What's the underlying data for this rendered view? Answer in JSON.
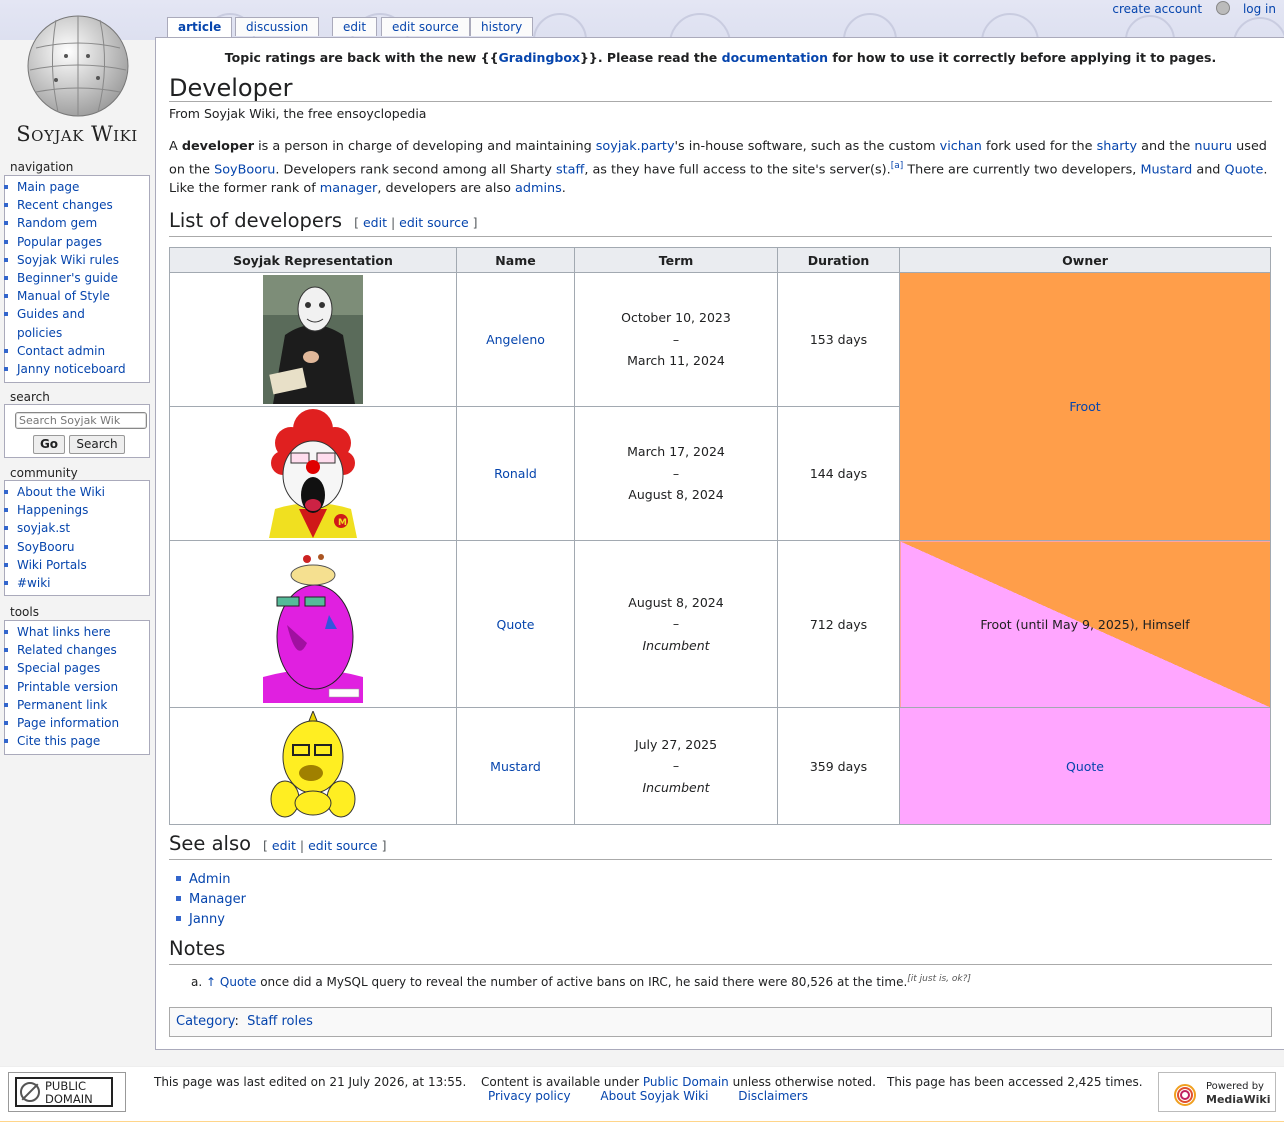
{
  "site": {
    "logo_text": "Soyjak Wiki"
  },
  "personal_tools": {
    "create_account": "create account",
    "log_in": "log in"
  },
  "tabs": [
    "article",
    "discussion",
    "edit",
    "edit source",
    "history"
  ],
  "sitenotice": {
    "before": "Topic ratings are back with the new {{",
    "link1": "Gradingbox",
    "middle": "}}. Please read the ",
    "link2": "documentation",
    "after": " for how to use it correctly before applying it to pages."
  },
  "page": {
    "title": "Developer",
    "tagline": "From Soyjak Wiki, the free ensoyclopedia"
  },
  "intro": {
    "t1": "A ",
    "bold": "developer",
    "t2": " is a person in charge of developing and maintaining ",
    "l1": "soyjak.party",
    "t3": "'s in-house software, such as the custom ",
    "l2": "vichan",
    "t4": " fork used for the ",
    "l3": "sharty",
    "t5": " and the ",
    "l4": "nuuru",
    "t6": " used on the ",
    "l5": "SoyBooru",
    "t7": ". Developers rank second among all Sharty ",
    "l6": "staff",
    "t8": ", as they have full access to the site's server(s).",
    "ref": "[a]",
    "t9": " There are currently two developers, ",
    "l7": "Mustard",
    "t10": " and ",
    "l8": "Quote",
    "t11": ". Like the former rank of ",
    "l9": "manager",
    "t12": ", developers are also ",
    "l10": "admins",
    "t13": "."
  },
  "sections": {
    "list_title": "List of developers",
    "see_also_title": "See also",
    "notes_title": "Notes",
    "edit": "edit",
    "edit_source": "edit source",
    "bracket_open": "[",
    "bracket_close": "]",
    "sep": "|"
  },
  "table": {
    "headers": [
      "Soyjak Representation",
      "Name",
      "Term",
      "Duration",
      "Owner"
    ],
    "rows": [
      {
        "name": "Angeleno",
        "start": "October 10, 2023",
        "dash": "–",
        "end": "March 11, 2024",
        "duration": "153 days"
      },
      {
        "name": "Ronald",
        "start": "March 17, 2024",
        "dash": "–",
        "end": "August 8, 2024",
        "duration": "144 days"
      },
      {
        "name": "Quote",
        "start": "August 8, 2024",
        "dash": "–",
        "end": "Incumbent",
        "duration": "712 days"
      },
      {
        "name": "Mustard",
        "start": "July 27, 2025",
        "dash": "–",
        "end": "Incumbent",
        "duration": "359 days"
      }
    ],
    "owners": [
      "Froot",
      "Froot (until May 9, 2025), Himself",
      "Quote"
    ],
    "colors": {
      "orange": "#ff9e4a",
      "pink": "#ffa6ff"
    }
  },
  "see_also": [
    "Admin",
    "Manager",
    "Janny"
  ],
  "notes": {
    "marker": "a.",
    "arrow": "↑",
    "link": "Quote",
    "text": " once did a MySQL query to reveal the number of active bans on IRC, he said there were 80,526 at the time.",
    "sup": "[it just is, ok?]"
  },
  "category": {
    "label": "Category",
    "colon": ":",
    "value": "Staff roles"
  },
  "sidebar": {
    "navigation": {
      "heading": "navigation",
      "items": [
        "Main page",
        "Recent changes",
        "Random gem",
        "Popular pages",
        "Soyjak Wiki rules",
        "Beginner's guide",
        "Manual of Style",
        "Guides and policies",
        "Contact admin",
        "Janny noticeboard"
      ]
    },
    "search": {
      "heading": "search",
      "placeholder": "Search Soyjak Wik",
      "go": "Go",
      "search": "Search"
    },
    "community": {
      "heading": "community",
      "items": [
        "About the Wiki",
        "Happenings",
        "soyjak.st",
        "SoyBooru",
        "Wiki Portals",
        "#wiki"
      ]
    },
    "tools": {
      "heading": "tools",
      "items": [
        "What links here",
        "Related changes",
        "Special pages",
        "Printable version",
        "Permanent link",
        "Page information",
        "Cite this page"
      ]
    }
  },
  "footer": {
    "badge_line1": "PUBLIC",
    "badge_line2": "DOMAIN",
    "last_edited": "This page was last edited on 21 July 2026, at 13:55.",
    "content_before": "Content is available under ",
    "content_link": "Public Domain",
    "content_after": " unless otherwise noted.",
    "accessed": "This page has been accessed 2,425 times.",
    "links": [
      "Privacy policy",
      "About Soyjak Wiki",
      "Disclaimers"
    ],
    "powered_1": "Powered by",
    "powered_2": "MediaWiki"
  }
}
